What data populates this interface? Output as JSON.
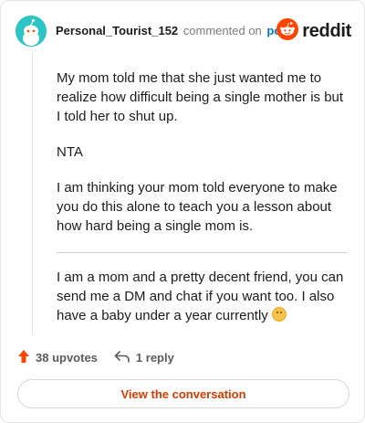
{
  "header": {
    "username": "Personal_Tourist_152",
    "commented_text": "commented on",
    "post_link": "post",
    "brand": "reddit",
    "avatar_icon": "snoo-avatar-icon",
    "brand_icon": "reddit-logo-icon"
  },
  "comment": {
    "paragraphs": [
      "My mom told me that she just wanted me to realize how difficult being a single mother is but I told her to shut up.",
      "NTA",
      "I am thinking your mom told everyone to make you do this alone to teach you a lesson about how hard being a single mom is."
    ],
    "after_divider": "I am a mom and a pretty decent friend, you can send me a DM and chat if you want too. I also have a baby under a year currently",
    "emoji": "blush-emoji"
  },
  "actions": {
    "upvotes": "38 upvotes",
    "replies": "1 reply",
    "upvote_icon": "upvote-arrow-icon",
    "reply_icon": "reply-arrow-icon"
  },
  "footer": {
    "view_button": "View the conversation"
  },
  "colors": {
    "accent": "#d93a00",
    "link": "#0079d3",
    "reddit_orange": "#ff4500",
    "upvote": "#ff4500",
    "avatar_bg": "#2ec4c4"
  }
}
